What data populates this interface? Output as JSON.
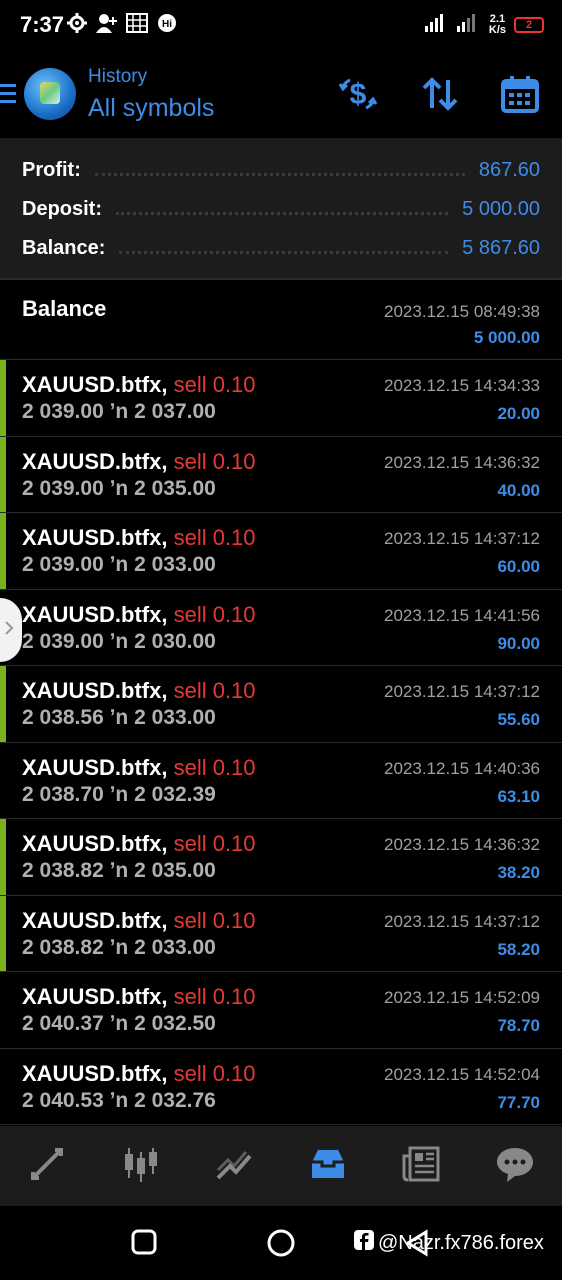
{
  "status_bar": {
    "time": "7:37",
    "net_speed_value": "2.1",
    "net_speed_unit": "K/s",
    "battery": "2",
    "icons": [
      "settings-icon",
      "add-user-icon",
      "grid-icon",
      "hi-icon",
      "signal-icon",
      "signal-icon"
    ]
  },
  "header": {
    "subtitle": "History",
    "title": "All symbols",
    "buttons": [
      "currency-icon",
      "sort-icon",
      "calendar-icon"
    ]
  },
  "summary": {
    "profit_label": "Profit:",
    "profit_value": "867.60",
    "deposit_label": "Deposit:",
    "deposit_value": "5 000.00",
    "balance_label": "Balance:",
    "balance_value": "5 867.60"
  },
  "balance_entry": {
    "label": "Balance",
    "datetime": "2023.12.15 08:49:38",
    "amount": "5 000.00"
  },
  "trades": [
    {
      "symbol": "XAUUSD.btfx,",
      "side": "sell 0.10",
      "prices": "2 039.00 ʼn  2 037.00",
      "datetime": "2023.12.15 14:34:33",
      "profit": "20.00",
      "accent": true
    },
    {
      "symbol": "XAUUSD.btfx,",
      "side": "sell 0.10",
      "prices": "2 039.00 ʼn  2 035.00",
      "datetime": "2023.12.15 14:36:32",
      "profit": "40.00",
      "accent": true
    },
    {
      "symbol": "XAUUSD.btfx,",
      "side": "sell 0.10",
      "prices": "2 039.00 ʼn  2 033.00",
      "datetime": "2023.12.15 14:37:12",
      "profit": "60.00",
      "accent": true
    },
    {
      "symbol": "XAUUSD.btfx,",
      "side": "sell 0.10",
      "prices": "2 039.00 ʼn  2 030.00",
      "datetime": "2023.12.15 14:41:56",
      "profit": "90.00",
      "accent": false
    },
    {
      "symbol": "XAUUSD.btfx,",
      "side": "sell 0.10",
      "prices": "2 038.56 ʼn  2 033.00",
      "datetime": "2023.12.15 14:37:12",
      "profit": "55.60",
      "accent": true
    },
    {
      "symbol": "XAUUSD.btfx,",
      "side": "sell 0.10",
      "prices": "2 038.70 ʼn  2 032.39",
      "datetime": "2023.12.15 14:40:36",
      "profit": "63.10",
      "accent": false
    },
    {
      "symbol": "XAUUSD.btfx,",
      "side": "sell 0.10",
      "prices": "2 038.82 ʼn  2 035.00",
      "datetime": "2023.12.15 14:36:32",
      "profit": "38.20",
      "accent": true
    },
    {
      "symbol": "XAUUSD.btfx,",
      "side": "sell 0.10",
      "prices": "2 038.82 ʼn  2 033.00",
      "datetime": "2023.12.15 14:37:12",
      "profit": "58.20",
      "accent": true
    },
    {
      "symbol": "XAUUSD.btfx,",
      "side": "sell 0.10",
      "prices": "2 040.37 ʼn  2 032.50",
      "datetime": "2023.12.15 14:52:09",
      "profit": "78.70",
      "accent": false
    },
    {
      "symbol": "XAUUSD.btfx,",
      "side": "sell 0.10",
      "prices": "2 040.53 ʼn  2 032.76",
      "datetime": "2023.12.15 14:52:04",
      "profit": "77.70",
      "accent": false
    }
  ],
  "nav": {
    "items": [
      "quotes-icon",
      "chart-icon",
      "trade-icon",
      "history-icon",
      "news-icon",
      "chat-icon"
    ],
    "active": "history-icon"
  },
  "watermark": "@Nazr.fx786.forex",
  "colors": {
    "accent_blue": "#3d8de8",
    "sell_red": "#e53935",
    "profit_green_bar": "#78b31e",
    "background": "#000000",
    "panel": "#1c1c1c"
  }
}
